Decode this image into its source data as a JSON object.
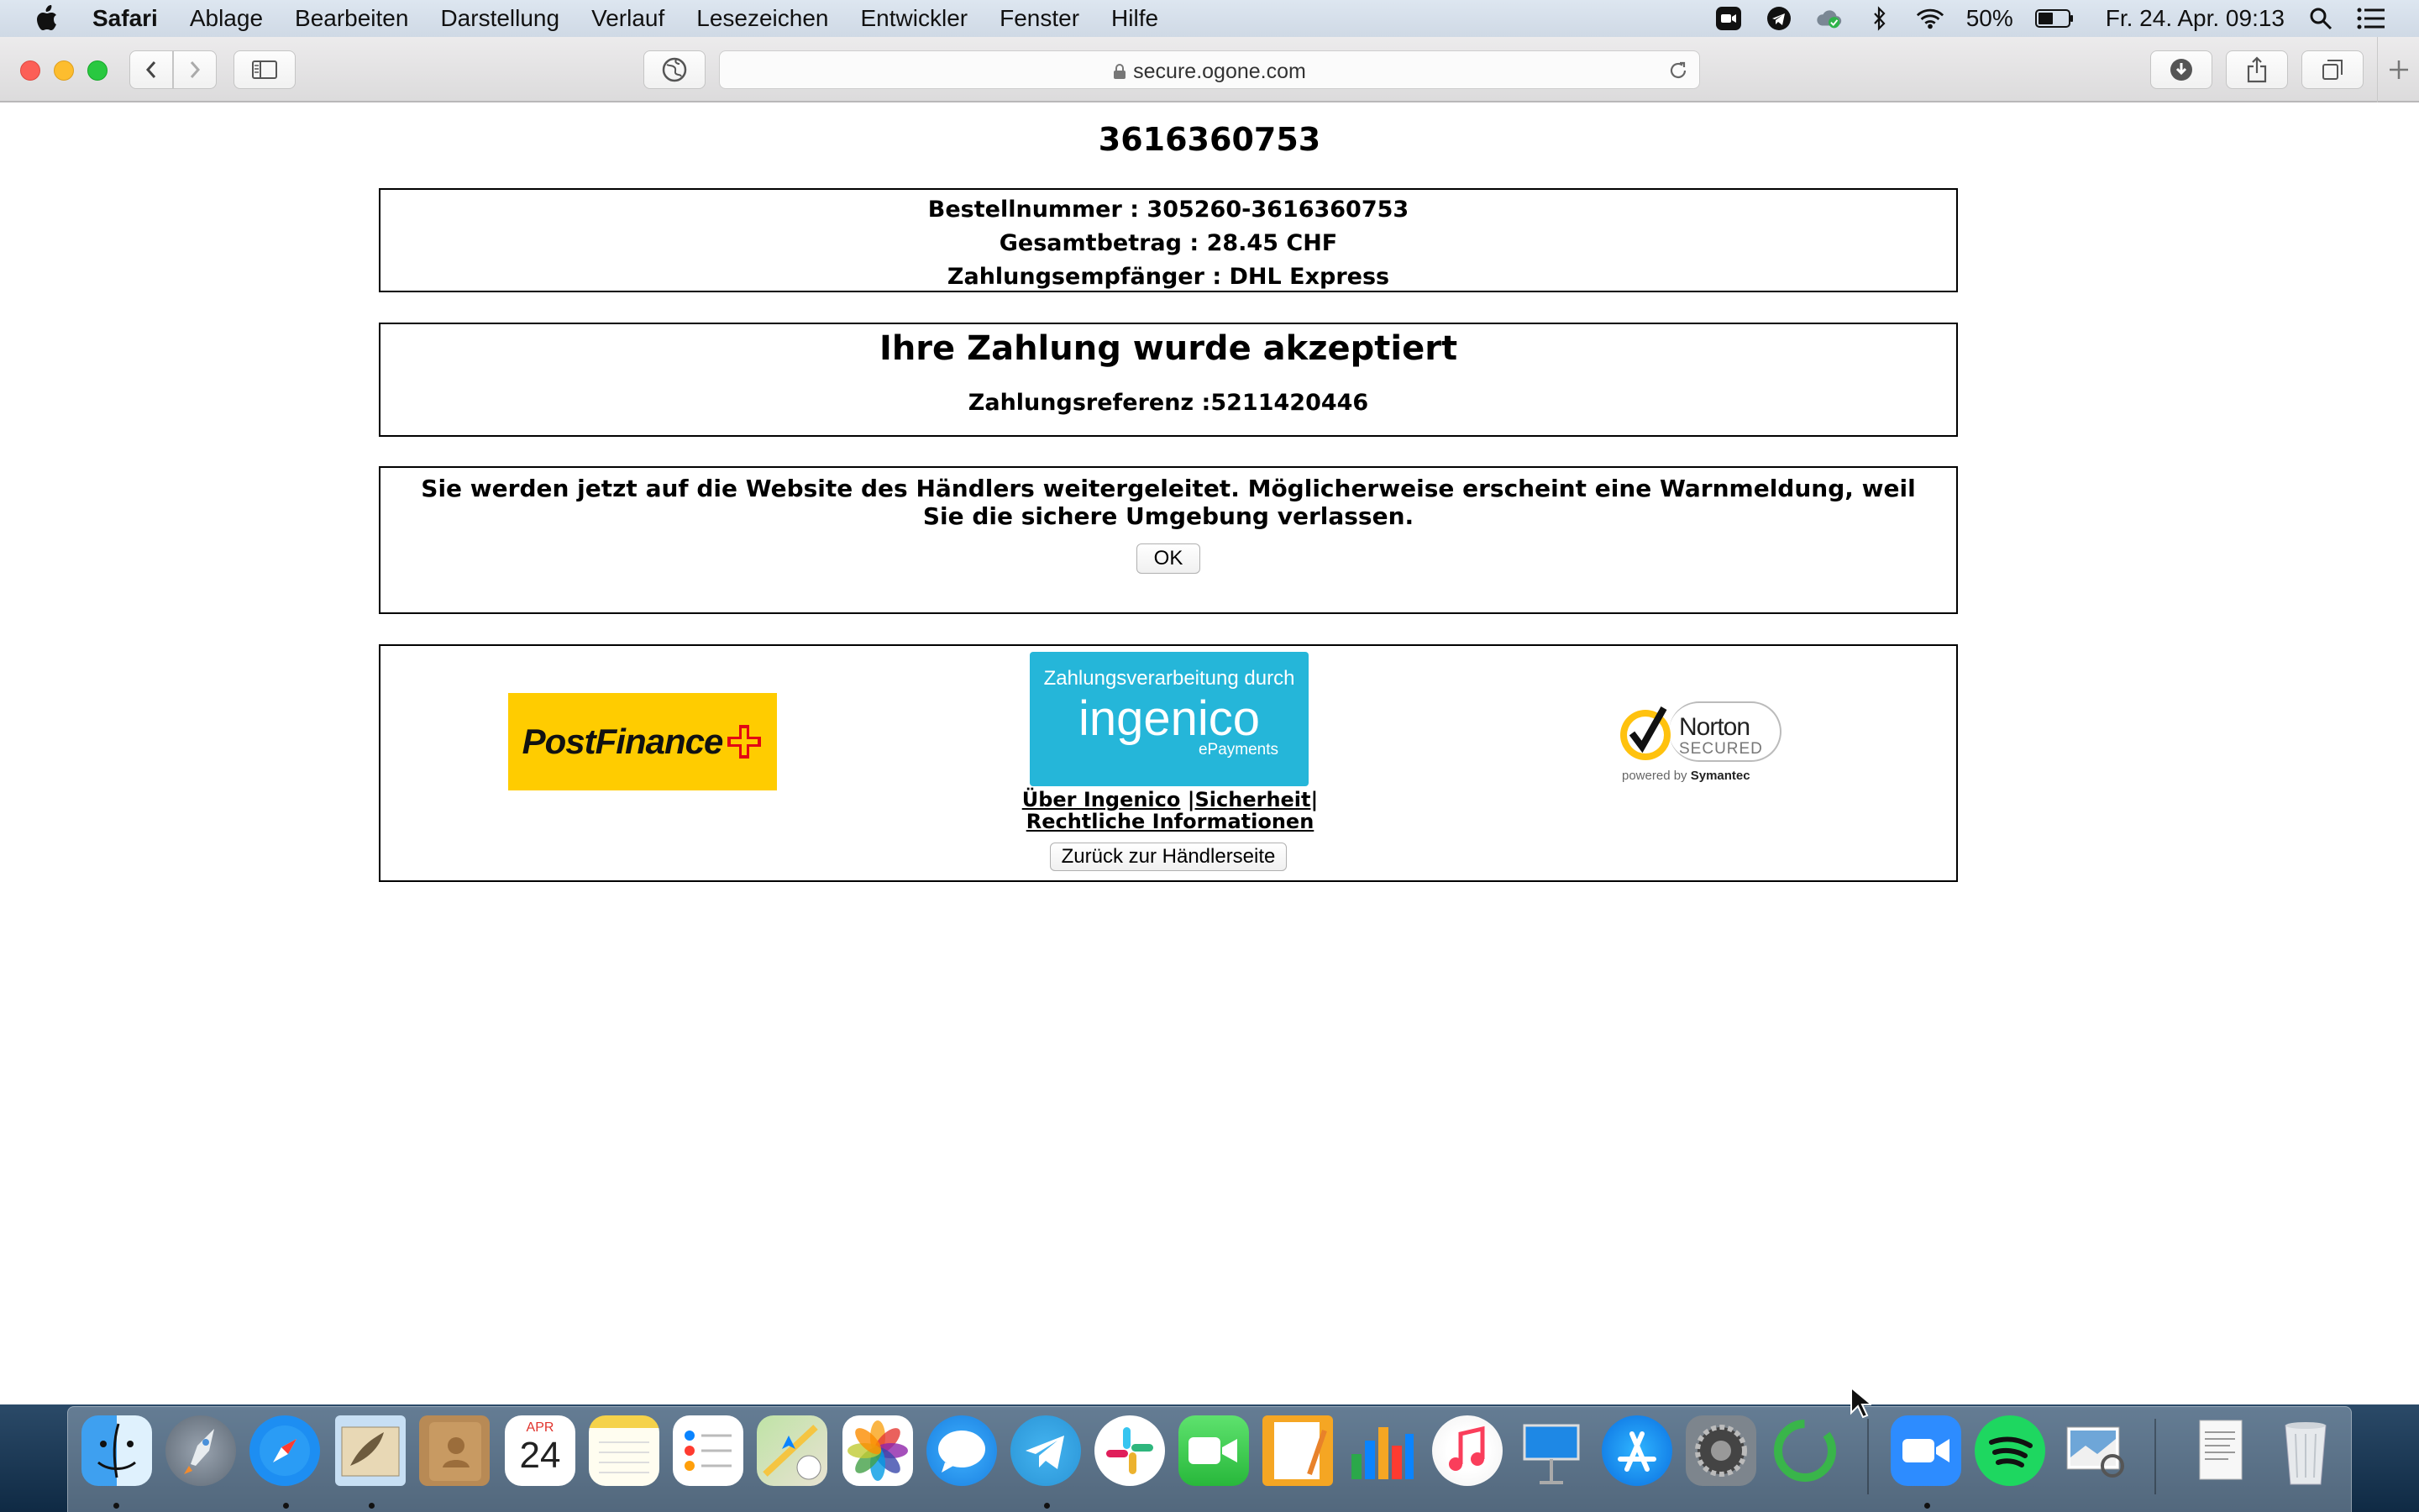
{
  "menubar": {
    "app_name": "Safari",
    "items": [
      "Ablage",
      "Bearbeiten",
      "Darstellung",
      "Verlauf",
      "Lesezeichen",
      "Entwickler",
      "Fenster",
      "Hilfe"
    ],
    "battery_text": "50%",
    "datetime": "Fr. 24. Apr. 09:13"
  },
  "browser": {
    "url": "secure.ogone.com"
  },
  "page": {
    "order_id": "3616360753",
    "order_info": {
      "order_number": "Bestellnummer : 305260-3616360753",
      "total_amount": "Gesamtbetrag : 28.45 CHF",
      "recipient": "Zahlungsempfänger : DHL Express"
    },
    "status": {
      "headline": "Ihre Zahlung wurde akzeptiert",
      "reference": "Zahlungsreferenz :5211420446"
    },
    "redirect": {
      "message": "Sie werden jetzt auf die Website des Händlers weitergeleitet. Möglicherweise erscheint eine Warnmeldung, weil Sie die sichere Umgebung verlassen.",
      "ok_label": "OK"
    },
    "footer": {
      "postfinance_logo": "PostFinance",
      "ingenico_tagline": "Zahlungsverarbeitung durch",
      "ingenico_name": "ingenico",
      "ingenico_sub": "ePayments",
      "link_about": "Über Ingenico",
      "link_security": "Sicherheit",
      "link_legal": "Rechtliche Informationen",
      "back_label": "Zurück zur Händlerseite",
      "norton_name": "Norton",
      "norton_secured": "SECURED",
      "norton_powered": "powered by",
      "norton_symantec": "Symantec"
    }
  },
  "dock": {
    "calendar_month": "APR",
    "calendar_day": "24",
    "apps": [
      "finder",
      "launchpad",
      "safari",
      "mail",
      "contacts",
      "calendar",
      "notes",
      "reminders",
      "maps",
      "photos",
      "messages",
      "telegram",
      "slack",
      "facetime",
      "pages",
      "numbers",
      "music",
      "keynote",
      "app-store",
      "system-preferences",
      "activity",
      "zoom",
      "spotify",
      "preview",
      "document",
      "trash"
    ]
  },
  "colors": {
    "postfinance_yellow": "#ffcc00",
    "postfinance_red": "#e30613",
    "ingenico_blue": "#25b6d9",
    "norton_yellow": "#ffc20e",
    "menubar_bg": "#d6dfea"
  }
}
